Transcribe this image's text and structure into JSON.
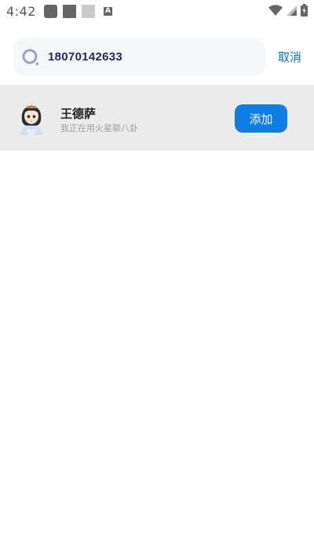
{
  "status_bar": {
    "time": "4:42",
    "notif_letter": "A",
    "icons": [
      "square-icon",
      "square-icon",
      "square-icon",
      "a-icon",
      "wifi-icon",
      "signal-icon",
      "battery-icon"
    ]
  },
  "search": {
    "value": "18070142633",
    "cancel_label": "取消",
    "accent": "#0b72d6"
  },
  "result": {
    "name": "王德萨",
    "signature": "我正在用火星聊八卦",
    "add_label": "添加",
    "button_color": "#0d7ee6",
    "row_background": "#ebebeb"
  }
}
